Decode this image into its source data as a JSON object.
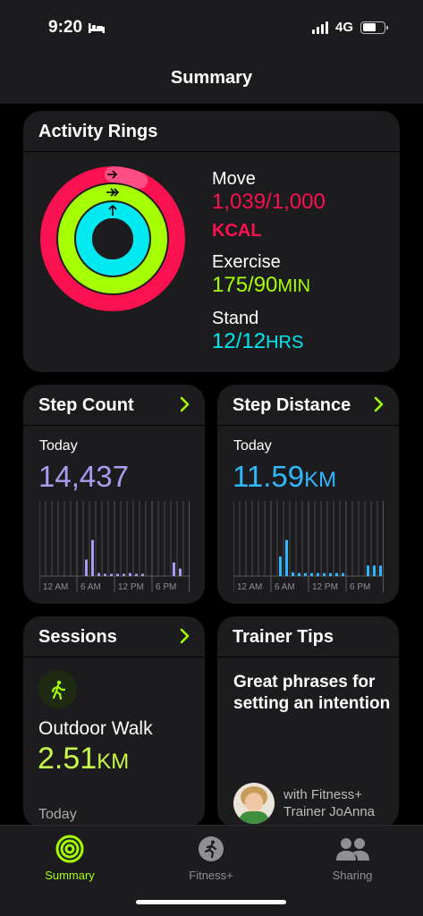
{
  "status": {
    "time": "9:20",
    "network": "4G",
    "sleep_icon": "bed-icon"
  },
  "nav": {
    "title": "Summary"
  },
  "activity_rings": {
    "title": "Activity Rings",
    "move": {
      "label": "Move",
      "value": "1,039/1,000",
      "unit": "KCAL",
      "color": "#fa114f"
    },
    "exercise": {
      "label": "Exercise",
      "value": "175/90",
      "unit": "MIN",
      "color": "#a6ff00"
    },
    "stand": {
      "label": "Stand",
      "value": "12/12",
      "unit": "HRS",
      "color": "#00f0ff"
    }
  },
  "step_count": {
    "title": "Step Count",
    "period": "Today",
    "value": "14,437",
    "color": "#a99cf0",
    "x_labels": [
      "12 AM",
      "6 AM",
      "12 PM",
      "6 PM"
    ],
    "bars": [
      0,
      0,
      0,
      0,
      0,
      0,
      0,
      0.22,
      0.48,
      0.04,
      0.03,
      0.03,
      0.03,
      0.03,
      0.04,
      0.03,
      0.03,
      0,
      0,
      0,
      0,
      0.18,
      0.1,
      0
    ]
  },
  "step_distance": {
    "title": "Step Distance",
    "period": "Today",
    "value": "11.59",
    "unit": "KM",
    "color": "#2fb8ff",
    "x_labels": [
      "12 AM",
      "6 AM",
      "12 PM",
      "6 PM"
    ],
    "bars": [
      0,
      0,
      0,
      0,
      0,
      0,
      0,
      0.26,
      0.48,
      0.05,
      0.04,
      0.04,
      0.04,
      0.04,
      0.04,
      0.04,
      0.04,
      0.04,
      0,
      0,
      0,
      0.14,
      0.14,
      0.14
    ]
  },
  "sessions": {
    "title": "Sessions",
    "workout": "Outdoor Walk",
    "value": "2.51",
    "unit": "KM",
    "date": "Today",
    "icon": "walking-figure-icon"
  },
  "trainer_tips": {
    "title": "Trainer Tips",
    "tip": "Great phrases for setting an intention",
    "trainer_line1": "with Fitness+",
    "trainer_line2": "Trainer JoAnna"
  },
  "tabs": [
    {
      "label": "Summary",
      "icon": "activity-rings-icon",
      "active": true,
      "color": "#a6ff00"
    },
    {
      "label": "Fitness+",
      "icon": "fitness-plus-icon",
      "active": false,
      "color": "#8e8e93"
    },
    {
      "label": "Sharing",
      "icon": "sharing-people-icon",
      "active": false,
      "color": "#8e8e93"
    }
  ]
}
